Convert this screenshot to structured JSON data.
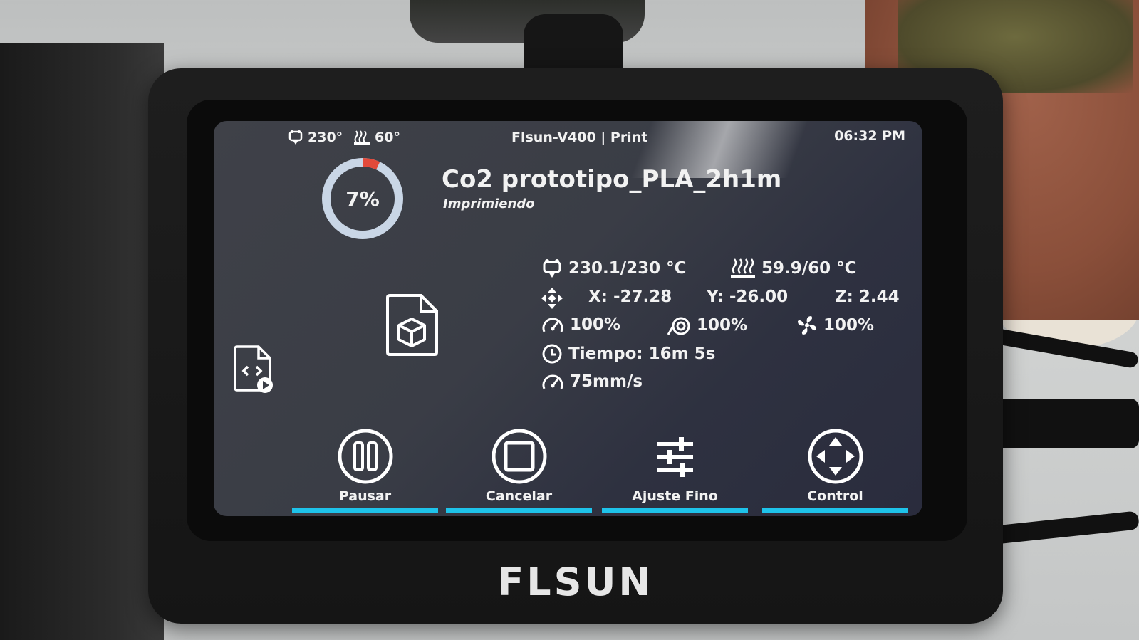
{
  "status_bar": {
    "extruder_temp": "230°",
    "bed_temp": "60°",
    "title": "Flsun-V400 | Print",
    "time": "06:32 PM"
  },
  "job": {
    "progress_label": "7%",
    "progress": 0.07,
    "filename": "Co2 prototipo_PLA_2h1m",
    "state": "Imprimiendo"
  },
  "readouts": {
    "extruder": "230.1/230 °C",
    "bed": "59.9/60 °C",
    "pos_x": "X: -27.28",
    "pos_y": "Y: -26.00",
    "pos_z": "Z: 2.44",
    "speed_factor": "100%",
    "flow_factor": "100%",
    "fan": "100%",
    "time_elapsed": "Tiempo: 16m 5s",
    "speed": "75mm/s"
  },
  "actions": [
    {
      "label": "Pausar",
      "icon": "pause-icon"
    },
    {
      "label": "Cancelar",
      "icon": "stop-icon"
    },
    {
      "label": "Ajuste Fino",
      "icon": "sliders-icon"
    },
    {
      "label": "Control",
      "icon": "dpad-icon"
    }
  ],
  "device": {
    "brand": "FLSUN"
  },
  "colors": {
    "accent": "#1ec3ea",
    "ring_track": "#c9d6e6",
    "ring_progress": "#e24a3b",
    "screen_bg": "#3a3d46"
  }
}
